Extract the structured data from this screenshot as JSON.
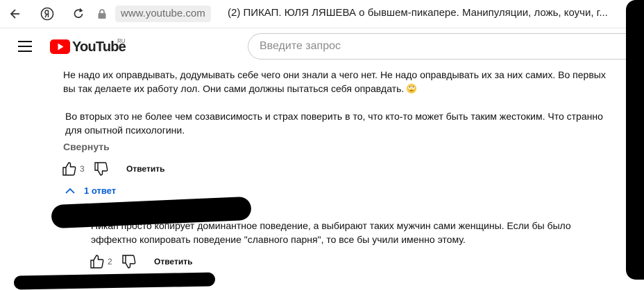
{
  "browser": {
    "url": "www.youtube.com",
    "tab_title": "(2) ПИКАП. ЮЛЯ ЛЯШЕВА о бывшем-пикапере. Манипуляции, ложь, коучи, г..."
  },
  "header": {
    "logo_text": "YouTube",
    "country_code": "RU",
    "search_placeholder": "Введите запрос"
  },
  "comment": {
    "paragraph1": "Не надо их оправдывать, додумывать себе чего они знали а чего нет. Не надо оправдывать их за них самих. Во первых вы так делаете их работу лол. Они сами должны пытаться себя оправдать.",
    "paragraph2": "Во вторых это не более чем созависимость и страх поверить в то, что кто-то может быть таким жестоким. Что странно для опытной психологини.",
    "collapse_label": "Свернуть",
    "like_count": "3",
    "reply_label": "Ответить",
    "replies_toggle": "1 ответ"
  },
  "reply": {
    "text": "Пикап просто копирует доминантное поведение, а выбирают таких мужчин сами женщины. Если бы было эффектно копировать поведение \"славного парня\", то все бы учили именно этому.",
    "like_count": "2",
    "reply_label": "Ответить"
  },
  "colors": {
    "link_blue": "#065fd4",
    "logo_red": "#ff0000",
    "muted_text": "#606060"
  },
  "icons": [
    "back-arrow-icon",
    "yandex-icon",
    "reload-icon",
    "lock-icon",
    "menu-icon",
    "youtube-play-icon",
    "thumb-up-icon",
    "thumb-down-icon",
    "chevron-up-icon"
  ]
}
